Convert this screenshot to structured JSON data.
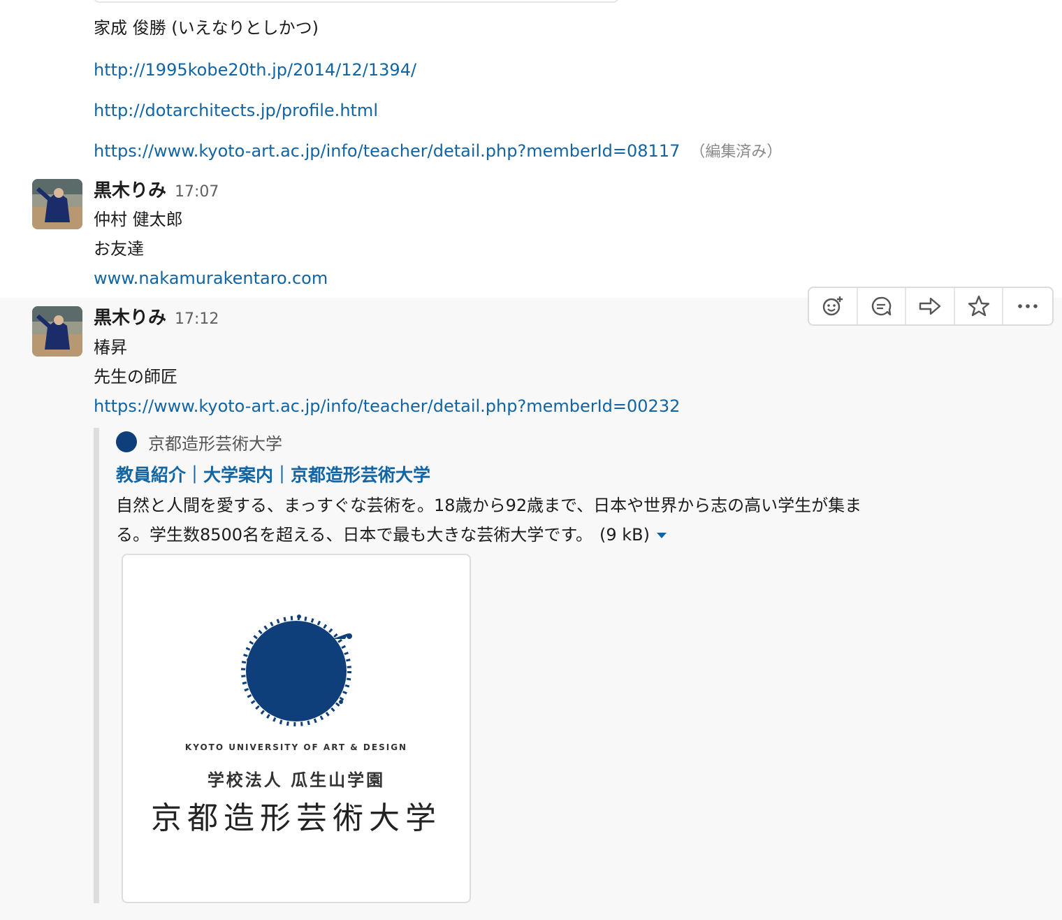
{
  "continuation": {
    "lines": [
      {
        "text": "家成 俊勝 (いえなりとしかつ)",
        "is_link": false
      },
      {
        "text": "http://1995kobe20th.jp/2014/12/1394/",
        "is_link": true
      },
      {
        "text": "http://dotarchitects.jp/profile.html",
        "is_link": true
      },
      {
        "text": "https://www.kyoto-art.ac.jp/info/teacher/detail.php?memberId=08117",
        "is_link": true
      }
    ],
    "edited_label": "（編集済み）"
  },
  "messages": [
    {
      "sender": "黒木りみ",
      "time": "17:07",
      "lines": [
        "仲村 健太郎",
        "お友達"
      ],
      "link": "www.nakamurakentaro.com"
    },
    {
      "sender": "黒木りみ",
      "time": "17:12",
      "lines": [
        "椿昇",
        "先生の師匠"
      ],
      "link": "https://www.kyoto-art.ac.jp/info/teacher/detail.php?memberId=00232"
    }
  ],
  "unfurl": {
    "service_name": "京都造形芸術大学",
    "title": "教員紹介｜大学案内｜京都造形芸術大学",
    "description": "自然と人間を愛する、まっすぐな芸術を。18歳から92歳まで、日本や世界から志の高い学生が集まる。学生数8500名を超える、日本で最も大きな芸術大学です。",
    "size": "(9 kB)",
    "image": {
      "en_text": "KYOTO UNIVERSITY OF ART & DESIGN",
      "corp_text": "学校法人 瓜生山学園",
      "name_text": "京都造形芸術大学",
      "brand_color": "#0f3f7a"
    }
  },
  "actions": [
    {
      "icon": "add-reaction-icon"
    },
    {
      "icon": "reply-thread-icon"
    },
    {
      "icon": "share-icon"
    },
    {
      "icon": "star-icon"
    },
    {
      "icon": "more-icon"
    }
  ],
  "colors": {
    "link": "#1264a3",
    "hover_background": "#f8f8f8",
    "attachment_border": "#dddddd"
  }
}
